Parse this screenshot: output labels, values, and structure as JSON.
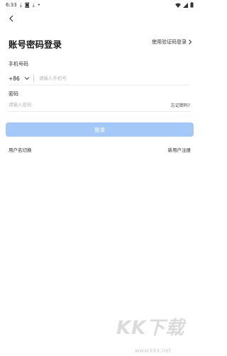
{
  "status_bar": {
    "time": "6:33"
  },
  "page": {
    "title": "账号密码登录",
    "sms_login_link": "使用验证码登录"
  },
  "form": {
    "phone_label": "手机号码",
    "country_code": "+86",
    "phone_placeholder": "请输入手机号",
    "password_label": "密码",
    "password_placeholder": "请输入密码",
    "forgot_password": "忘记密码?",
    "login_button": "登录"
  },
  "footer": {
    "switch_user": "用户名切换",
    "register": "新用户注册"
  },
  "watermark": {
    "brand": "KK下载",
    "url": "www.kkx.net"
  },
  "colors": {
    "login_button_bg": "#a4c8f7",
    "text": "#222222"
  }
}
